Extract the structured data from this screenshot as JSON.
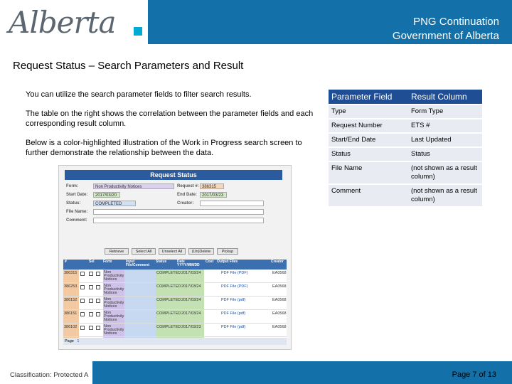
{
  "header": {
    "logo_text": "Alberta",
    "line1": "PNG Continuation",
    "line2": "Government of Alberta",
    "colors": {
      "band": "#1470a8",
      "logo_square": "#00aad2"
    }
  },
  "title": "Request Status – Search Parameters and Result",
  "paragraphs": [
    "You can utilize the search parameter fields to filter search results.",
    "The table on the right shows the correlation between the parameter fields and each corresponding result column.",
    "Below is a color-highlighted illustration of the Work in Progress search screen to further demonstrate the relationship between the data."
  ],
  "mapping_table": {
    "headers": [
      "Parameter Field",
      "Result Column"
    ],
    "rows": [
      [
        "Type",
        "Form Type"
      ],
      [
        "Request Number",
        "ETS #"
      ],
      [
        "Start/End Date",
        "Last Updated"
      ],
      [
        "Status",
        "Status"
      ],
      [
        "File Name",
        "(not shown as a result column)"
      ],
      [
        "Comment",
        "(not shown as a result column)"
      ]
    ]
  },
  "screenshot": {
    "title": "Request Status",
    "form_label": "Form:",
    "form_value": "Non Productivity Notices",
    "request_label": "Request #:",
    "request_value": "386315",
    "start_label": "Start Date:",
    "start_value": "2017/03/20",
    "end_label": "End Date:",
    "end_value": "2017/03/23",
    "status_label": "Status:",
    "status_value": "COMPLETED",
    "creator_label": "Creator:",
    "filename_label": "File Name:",
    "comment_label": "Comment:",
    "buttons": [
      "Retrieve",
      "Select All",
      "Unselect All",
      "(Un)Delete",
      "Pickup"
    ],
    "grid_headers": [
      "#",
      "Sel",
      "Form",
      "Input File/Comment",
      "Status",
      "Date YYYY/MM/DD",
      "Cost",
      "Output Files",
      "Creator"
    ],
    "rows": [
      {
        "num": "386315",
        "form": "Non Productivity Notices",
        "status": "COMPLETED",
        "date": "2017/03/24",
        "output": "PDF File (PDF)",
        "creator": "EA0568"
      },
      {
        "num": "386253",
        "form": "Non Productivity Notices",
        "status": "COMPLETED",
        "date": "2017/03/24",
        "output": "PDF File (PDF)",
        "creator": "EA0568"
      },
      {
        "num": "386152",
        "form": "Non Productivity Notices",
        "status": "COMPLETED",
        "date": "2017/03/24",
        "output": "PDF File (pdf)",
        "creator": "EA0568"
      },
      {
        "num": "386151",
        "form": "Non Productivity Notices",
        "status": "COMPLETED",
        "date": "2017/03/24",
        "output": "PDF File (pdf)",
        "creator": "EA0568"
      },
      {
        "num": "386102",
        "form": "Non Productivity Notices",
        "status": "COMPLETED",
        "date": "2017/03/23",
        "output": "PDF File (pdf)",
        "creator": "EA0568"
      }
    ],
    "page_label": "Page",
    "page_value": "1"
  },
  "footer": {
    "classification": "Classification: Protected A",
    "page": "Page 7 of 13"
  }
}
